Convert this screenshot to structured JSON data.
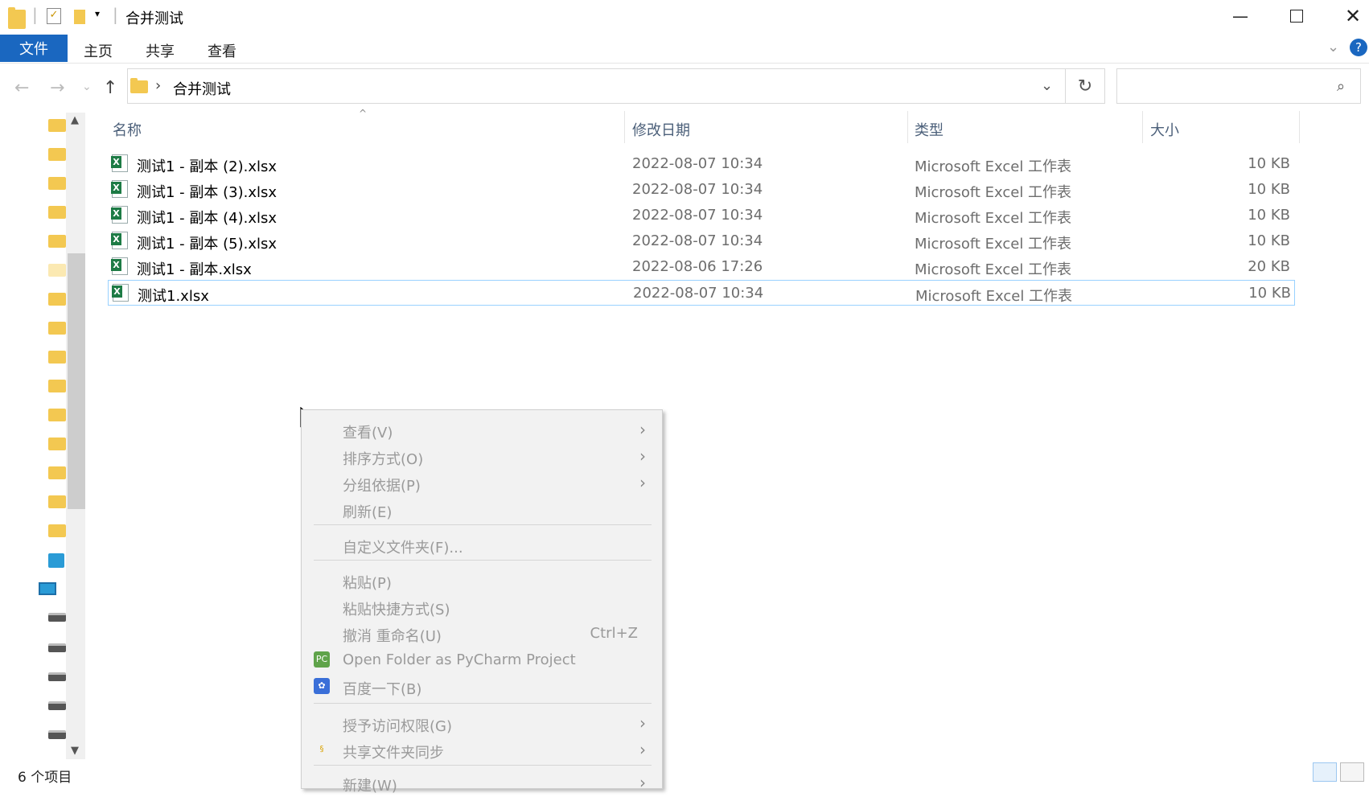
{
  "window": {
    "title": "合并测试"
  },
  "ribbon": {
    "tabs": [
      "文件",
      "主页",
      "共享",
      "查看"
    ]
  },
  "address": {
    "path": "合并测试",
    "separator": "›"
  },
  "columns": {
    "name": "名称",
    "date": "修改日期",
    "type": "类型",
    "size": "大小"
  },
  "files": [
    {
      "name": "测试1 - 副本 (2).xlsx",
      "date": "2022-08-07 10:34",
      "type": "Microsoft Excel 工作表",
      "size": "10 KB"
    },
    {
      "name": "测试1 - 副本 (3).xlsx",
      "date": "2022-08-07 10:34",
      "type": "Microsoft Excel 工作表",
      "size": "10 KB"
    },
    {
      "name": "测试1 - 副本 (4).xlsx",
      "date": "2022-08-07 10:34",
      "type": "Microsoft Excel 工作表",
      "size": "10 KB"
    },
    {
      "name": "测试1 - 副本 (5).xlsx",
      "date": "2022-08-07 10:34",
      "type": "Microsoft Excel 工作表",
      "size": "10 KB"
    },
    {
      "name": "测试1 - 副本.xlsx",
      "date": "2022-08-06 17:26",
      "type": "Microsoft Excel 工作表",
      "size": "20 KB"
    },
    {
      "name": "测试1.xlsx",
      "date": "2022-08-07 10:34",
      "type": "Microsoft Excel 工作表",
      "size": "10 KB"
    }
  ],
  "context_menu": {
    "view": "查看(V)",
    "sort": "排序方式(O)",
    "group": "分组依据(P)",
    "refresh": "刷新(E)",
    "customize": "自定义文件夹(F)...",
    "paste": "粘贴(P)",
    "paste_shortcut": "粘贴快捷方式(S)",
    "undo": "撤消 重命名(U)",
    "undo_shortcut": "Ctrl+Z",
    "pycharm": "Open Folder as PyCharm Project",
    "baidu": "百度一下(B)",
    "grant": "授予访问权限(G)",
    "sync": "共享文件夹同步",
    "new": "新建(W)"
  },
  "status": {
    "count": "6 个项目"
  },
  "colors": {
    "accent": "#1a67c0",
    "excel": "#1d7b45",
    "folder": "#f3c851"
  }
}
